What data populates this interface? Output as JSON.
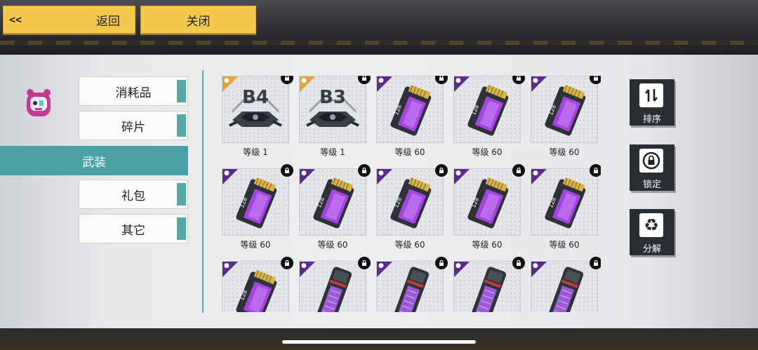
{
  "top": {
    "back_arrows": "<<",
    "back_label": "返回",
    "close_label": "关闭"
  },
  "categories": [
    {
      "label": "消耗品",
      "active": false
    },
    {
      "label": "碎片",
      "active": false
    },
    {
      "label": "武装",
      "active": true
    },
    {
      "label": "礼包",
      "active": false
    },
    {
      "label": "其它",
      "active": false
    }
  ],
  "items": [
    {
      "kind": "base",
      "text": "B4",
      "rarity": "gold",
      "level": "等级 1"
    },
    {
      "kind": "base",
      "text": "B3",
      "rarity": "gold",
      "level": "等级 1"
    },
    {
      "kind": "chip",
      "text": "128",
      "rarity": "purple",
      "level": "等级 60"
    },
    {
      "kind": "chip",
      "text": "128",
      "rarity": "purple",
      "level": "等级 60"
    },
    {
      "kind": "chip",
      "text": "128",
      "rarity": "purple",
      "level": "等级 60"
    },
    {
      "kind": "chip",
      "text": "128",
      "rarity": "purple",
      "level": "等级 60"
    },
    {
      "kind": "chip",
      "text": "128",
      "rarity": "purple",
      "level": "等级 60"
    },
    {
      "kind": "chip",
      "text": "128",
      "rarity": "purple",
      "level": "等级 60"
    },
    {
      "kind": "chip",
      "text": "128",
      "rarity": "purple",
      "level": "等级 60"
    },
    {
      "kind": "chip",
      "text": "128",
      "rarity": "purple",
      "level": "等级 60"
    },
    {
      "kind": "chip",
      "text": "128",
      "rarity": "purple",
      "level": ""
    },
    {
      "kind": "reader",
      "text": "",
      "rarity": "purple",
      "level": ""
    },
    {
      "kind": "reader",
      "text": "",
      "rarity": "purple",
      "level": ""
    },
    {
      "kind": "reader",
      "text": "",
      "rarity": "purple",
      "level": ""
    },
    {
      "kind": "reader",
      "text": "",
      "rarity": "purple",
      "level": ""
    }
  ],
  "side_buttons": [
    {
      "label": "排序",
      "icon": "sort-icon"
    },
    {
      "label": "锁定",
      "icon": "lock-icon"
    },
    {
      "label": "分解",
      "icon": "recycle-icon"
    }
  ],
  "colors": {
    "accent": "#4aa0a4",
    "button_yellow": "#f2c94c",
    "rarity_purple": "#5a2a8c",
    "rarity_gold": "#e3a23a"
  }
}
